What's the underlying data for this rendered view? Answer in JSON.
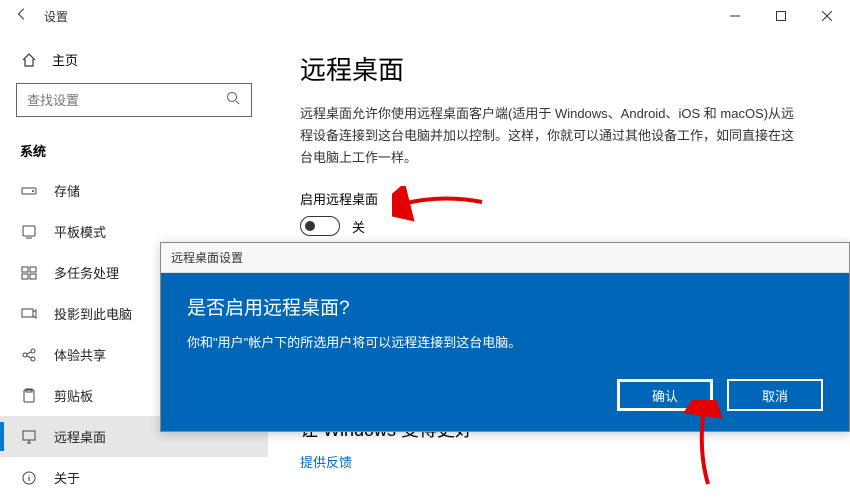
{
  "titlebar": {
    "title": "设置"
  },
  "sidebar": {
    "home": "主页",
    "search_placeholder": "查找设置",
    "section": "系统",
    "items": [
      {
        "label": "存储"
      },
      {
        "label": "平板模式"
      },
      {
        "label": "多任务处理"
      },
      {
        "label": "投影到此电脑"
      },
      {
        "label": "体验共享"
      },
      {
        "label": "剪贴板"
      },
      {
        "label": "远程桌面"
      },
      {
        "label": "关于"
      }
    ]
  },
  "content": {
    "heading": "远程桌面",
    "desc": "远程桌面允许你使用远程桌面客户端(适用于 Windows、Android、iOS 和 macOS)从远程设备连接到这台电脑并加以控制。这样，你就可以通过其他设备工作，如同直接在这台电脑上工作一样。",
    "toggle_label": "启用远程桌面",
    "toggle_state": "关",
    "section2_heading": "让 Windows 变得更好",
    "section2_link": "提供反馈"
  },
  "dialog": {
    "title": "远程桌面设置",
    "heading": "是否启用远程桌面?",
    "body": "你和\"用户\"帐户下的所选用户将可以远程连接到这台电脑。",
    "confirm": "确认",
    "cancel": "取消"
  }
}
